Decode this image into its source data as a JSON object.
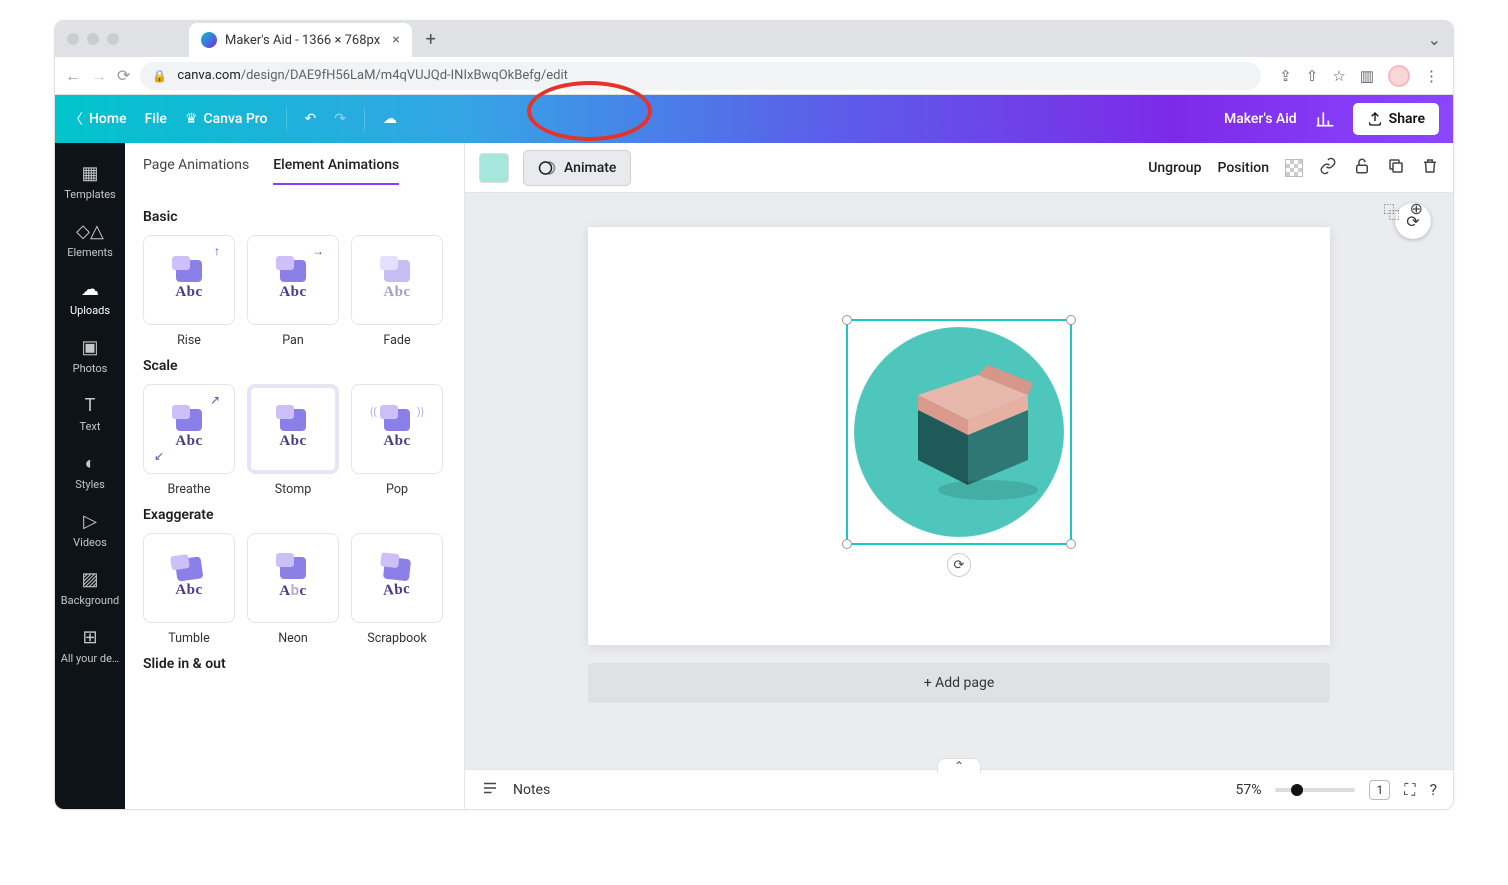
{
  "browser": {
    "tab_title": "Maker's Aid - 1366 × 768px",
    "url_host": "canva.com",
    "url_path": "/design/DAE9fH56LaM/m4qVUJQd-INIxBwqOkBefg/edit"
  },
  "topbar": {
    "home": "Home",
    "file": "File",
    "pro": "Canva Pro",
    "project_name": "Maker's Aid",
    "share": "Share"
  },
  "rail": {
    "items": [
      {
        "icon": "▦",
        "label": "Templates"
      },
      {
        "icon": "◇△",
        "label": "Elements"
      },
      {
        "icon": "☁",
        "label": "Uploads",
        "active": true
      },
      {
        "icon": "▣",
        "label": "Photos"
      },
      {
        "icon": "T",
        "label": "Text"
      },
      {
        "icon": "◐",
        "label": "Styles"
      },
      {
        "icon": "▷",
        "label": "Videos"
      },
      {
        "icon": "▨",
        "label": "Background"
      },
      {
        "icon": "⊞",
        "label": "All your de…"
      }
    ]
  },
  "animations": {
    "tabs": {
      "page": "Page Animations",
      "element": "Element Animations",
      "active": "element"
    },
    "sections": [
      {
        "title": "Basic",
        "items": [
          {
            "name": "Rise",
            "arrow": "↑"
          },
          {
            "name": "Pan",
            "arrow": "→"
          },
          {
            "name": "Fade"
          }
        ]
      },
      {
        "title": "Scale",
        "items": [
          {
            "name": "Breathe",
            "arrow": "↗",
            "arrow2": "↙"
          },
          {
            "name": "Stomp"
          },
          {
            "name": "Pop"
          }
        ]
      },
      {
        "title": "Exaggerate",
        "items": [
          {
            "name": "Tumble"
          },
          {
            "name": "Neon"
          },
          {
            "name": "Scrapbook"
          }
        ]
      },
      {
        "title": "Slide in & out",
        "items": [
          {
            "name": ""
          },
          {
            "name": ""
          },
          {
            "name": ""
          }
        ]
      }
    ]
  },
  "context": {
    "animate": "Animate",
    "ungroup": "Ungroup",
    "position": "Position",
    "swatch": "#a5e7dd"
  },
  "canvas": {
    "add_page": "+ Add page"
  },
  "bottombar": {
    "notes": "Notes",
    "zoom": "57%",
    "page_count": "1"
  }
}
